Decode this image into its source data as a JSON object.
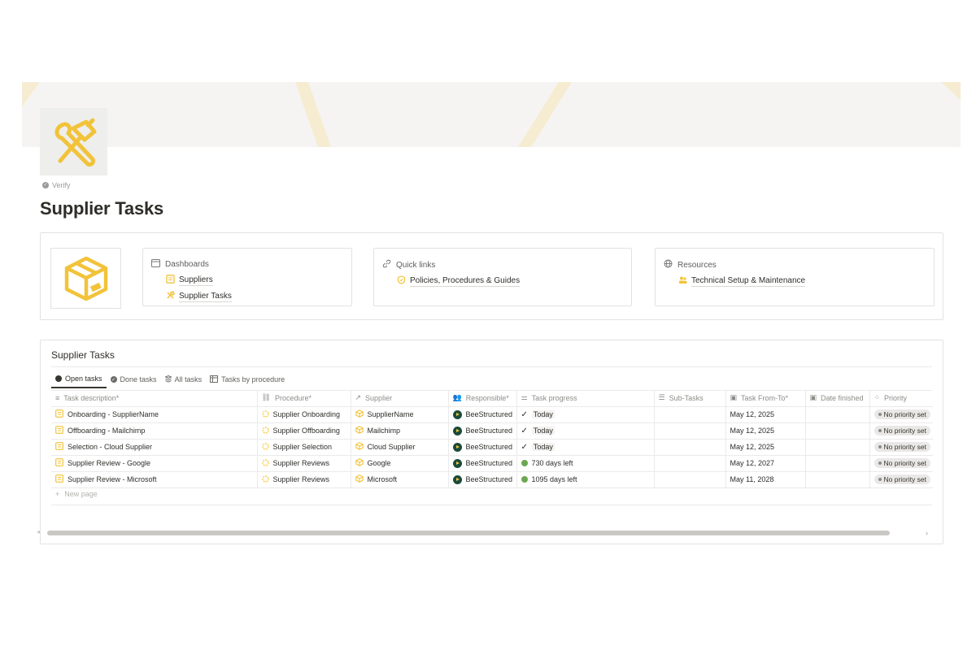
{
  "page": {
    "verify_label": "Verify",
    "title": "Supplier Tasks"
  },
  "colors": {
    "accent": "#f2c33a",
    "cover_bg": "#f5f4f2",
    "cover_stripe": "#f6ecd1"
  },
  "nav": {
    "dashboards": {
      "heading": "Dashboards",
      "links": [
        {
          "label": "Suppliers",
          "icon": "document-icon"
        },
        {
          "label": "Supplier Tasks",
          "icon": "tools-icon"
        }
      ]
    },
    "quick_links": {
      "heading": "Quick links",
      "links": [
        {
          "label": "Policies, Procedures & Guides",
          "icon": "shield-icon"
        }
      ]
    },
    "resources": {
      "heading": "Resources",
      "links": [
        {
          "label": "Technical Setup & Maintenance",
          "icon": "people-icon"
        }
      ]
    }
  },
  "database": {
    "title": "Supplier Tasks",
    "views": [
      "Open tasks",
      "Done tasks",
      "All tasks",
      "Tasks by procedure"
    ],
    "columns": [
      "Task description*",
      "Procedure*",
      "Supplier",
      "Responsible*",
      "Task progress",
      "Sub-Tasks",
      "Task From-To*",
      "Date finished",
      "Priority"
    ],
    "rows": [
      {
        "task": "Onboarding - SupplierName",
        "procedure": "Supplier Onboarding",
        "supplier": "SupplierName",
        "responsible": "BeeStructured",
        "progress": "Today",
        "progress_type": "check",
        "subtasks": "",
        "from_to": "May 12, 2025",
        "finished": "",
        "priority": "No priority set"
      },
      {
        "task": "Offboarding - Mailchimp",
        "procedure": "Supplier Offboarding",
        "supplier": "Mailchimp",
        "responsible": "BeeStructured",
        "progress": "Today",
        "progress_type": "check",
        "subtasks": "",
        "from_to": "May 12, 2025",
        "finished": "",
        "priority": "No priority set"
      },
      {
        "task": "Selection - Cloud Supplier",
        "procedure": "Supplier Selection",
        "supplier": "Cloud Supplier",
        "responsible": "BeeStructured",
        "progress": "Today",
        "progress_type": "check",
        "subtasks": "",
        "from_to": "May 12, 2025",
        "finished": "",
        "priority": "No priority set"
      },
      {
        "task": "Supplier Review - Google",
        "procedure": "Supplier Reviews",
        "supplier": "Google",
        "responsible": "BeeStructured",
        "progress": "730 days left",
        "progress_type": "dot",
        "subtasks": "",
        "from_to": "May 12, 2027",
        "finished": "",
        "priority": "No priority set"
      },
      {
        "task": "Supplier Review - Microsoft",
        "procedure": "Supplier Reviews",
        "supplier": "Microsoft",
        "responsible": "BeeStructured",
        "progress": "1095 days left",
        "progress_type": "dot",
        "subtasks": "",
        "from_to": "May 11, 2028",
        "finished": "",
        "priority": "No priority set"
      }
    ],
    "new_page_label": "New page"
  }
}
